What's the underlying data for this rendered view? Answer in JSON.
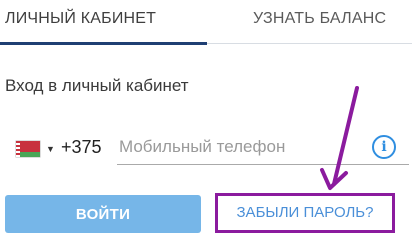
{
  "tabs": {
    "active_label": "ЛИЧНЫЙ КАБИНЕТ",
    "other_label": "УЗНАТЬ БАЛАНС"
  },
  "login": {
    "title": "Вход в личный кабинет",
    "country_code": "+375",
    "phone_placeholder": "Мобильный телефон",
    "submit_label": "ВОЙТИ",
    "forgot_label": "ЗАБЫЛИ ПАРОЛЬ?"
  },
  "icons": {
    "flag": "belarus-flag-icon",
    "caret": "caret-down-icon",
    "info": "info-icon",
    "annotation": "purple-arrow-annotation"
  },
  "colors": {
    "tab_underline": "#1f3f73",
    "login_button": "#76b6e8",
    "link": "#4a8fd8",
    "info": "#2f8ee0",
    "annotation": "#8b1b9e"
  }
}
